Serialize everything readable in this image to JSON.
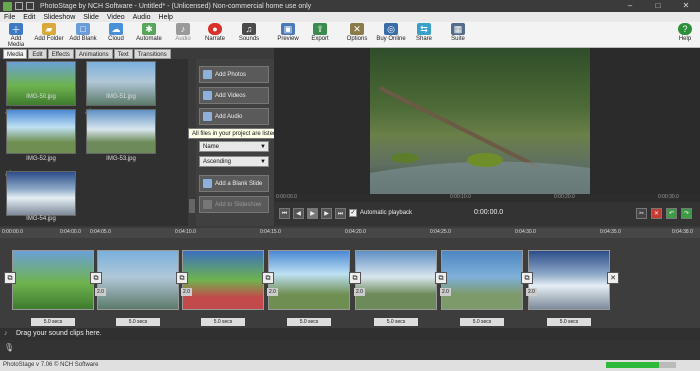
{
  "window": {
    "title": "PhotoStage by NCH Software - Untitled* - (Unlicensed) Non-commercial home use only",
    "minimize": "–",
    "maximize": "□",
    "close": "✕"
  },
  "menu": [
    "File",
    "Edit",
    "Slideshow",
    "Slide",
    "Video",
    "Audio",
    "Help"
  ],
  "toolbar": [
    {
      "label": "Add Media",
      "icon": "add-media-icon",
      "color": "#3f7bc4"
    },
    {
      "label": "Add Folder",
      "icon": "add-folder-icon",
      "color": "#d9a93a"
    },
    {
      "label": "Add Blank",
      "icon": "add-blank-icon",
      "color": "#6a9cd8"
    },
    {
      "label": "Cloud",
      "icon": "cloud-icon",
      "color": "#4a90d9"
    },
    {
      "label": "Automate",
      "icon": "automate-icon",
      "color": "#58a55c"
    },
    {
      "label": "Audio",
      "icon": "audio-icon",
      "color": "#9a9a9a"
    },
    {
      "label": "Narrate",
      "icon": "narrate-icon",
      "color": "#d9302c"
    },
    {
      "label": "Sounds",
      "icon": "sounds-icon",
      "color": "#4a4a4a"
    },
    {
      "label": "Preview",
      "icon": "preview-icon",
      "color": "#4a7bb6"
    },
    {
      "label": "Export",
      "icon": "export-icon",
      "color": "#3b8c4e"
    },
    {
      "label": "Options",
      "icon": "options-icon",
      "color": "#8c7b4a"
    },
    {
      "label": "Buy Online",
      "icon": "buy-online-icon",
      "color": "#3a6da8"
    },
    {
      "label": "Share",
      "icon": "share-icon",
      "color": "#3aa0c8"
    },
    {
      "label": "Suite",
      "icon": "suite-icon",
      "color": "#556b8a"
    },
    {
      "label": "Help",
      "icon": "help-icon",
      "color": "#2d8f3a"
    }
  ],
  "tabs": [
    "Media",
    "Edit",
    "Effects",
    "Animations",
    "Text",
    "Transitions"
  ],
  "media_items": [
    {
      "name": "IMG-50.jpg"
    },
    {
      "name": "IMG-51.jpg"
    },
    {
      "name": "IMG-52.jpg"
    },
    {
      "name": "IMG-53.jpg"
    },
    {
      "name": "IMG-54.jpg"
    }
  ],
  "side_panel": {
    "add_photos": "Add Photos",
    "add_videos": "Add Videos",
    "add_audio": "Add Audio",
    "sort_by": "Name",
    "sort_order": "Ascending",
    "add_blank": "Add a Blank Slide",
    "add_to_slideshow": "Add to Slideshow"
  },
  "tooltip": "All files in your project are listed here",
  "preview": {
    "ruler": [
      "0:00:00.0",
      "0:00:10.0",
      "0:00:20.0",
      "0:00:30.0"
    ],
    "automatic_playback": "Automatic playback",
    "time": "0:00:00.0"
  },
  "timeline": {
    "ticks": [
      "0:00:00.0",
      "0:04:00.0",
      "0:04:05.0",
      "0:04:10.0",
      "0:04:15.0",
      "0:04:20.0",
      "0:04:25.0",
      "0:04:30.0",
      "0:04:35.0",
      "0:04:38.0"
    ],
    "durations": [
      "5.0 secs",
      "5.0 secs",
      "5.0 secs",
      "5.0 secs",
      "5.0 secs",
      "5.0 secs",
      "5.0 secs"
    ],
    "transition_labels": [
      "2.0",
      "2.0",
      "2.0",
      "2.0",
      "2.0",
      "2.0"
    ],
    "sound_hint": "Drag your sound clips here."
  },
  "status": {
    "text": "PhotoStage v 7.06 © NCH Software",
    "progress": 0.75,
    "progress_color": "#2fb83a"
  }
}
